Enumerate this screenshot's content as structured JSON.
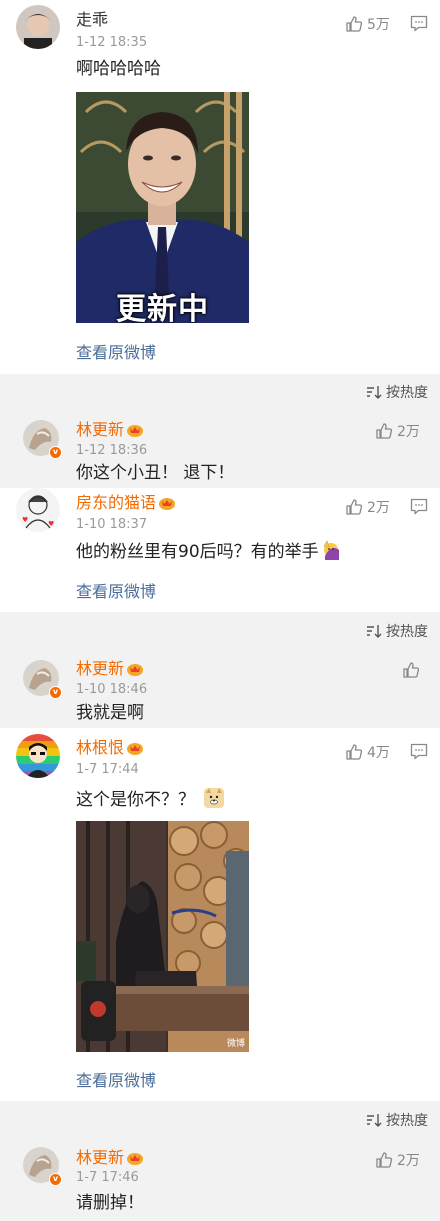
{
  "comments": [
    {
      "name": "走乖",
      "time": "1-12 18:35",
      "text": "啊哈哈哈哈",
      "likes": "5万",
      "image_caption": "更新中",
      "view_original": "查看原微博"
    },
    {
      "name": "房东的猫语",
      "time": "1-10 18:37",
      "text": "他的粉丝里有90后吗？有的举手",
      "likes": "2万",
      "view_original": "查看原微博"
    },
    {
      "name": "林根恨",
      "time": "1-7 17:44",
      "text": "这个是你不？？",
      "likes": "4万",
      "image_watermark": "微博",
      "view_original": "查看原微博"
    }
  ],
  "replies": [
    {
      "name": "林更新",
      "time": "1-12 18:36",
      "text": "你这个小丑！ 退下！",
      "likes": "2万"
    },
    {
      "name": "林更新",
      "time": "1-10 18:46",
      "text": "我就是啊",
      "likes": ""
    },
    {
      "name": "林更新",
      "time": "1-7 17:46",
      "text": "请删掉！",
      "likes": "2万"
    }
  ],
  "sort_label": "按热度",
  "colors": {
    "vip_name": "#f56a00",
    "link": "#4a6d9a",
    "muted": "#9a9a9a",
    "reply_bg": "#f2f2f2"
  }
}
